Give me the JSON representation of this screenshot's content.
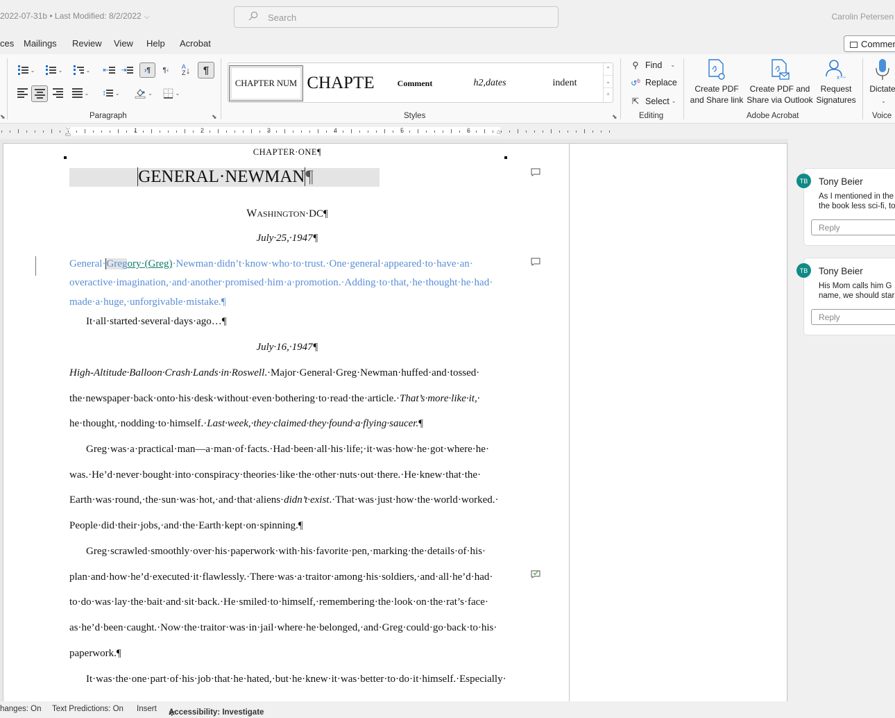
{
  "titlebar": {
    "doc_meta": "2022-07-31b  •  Last Modified: 8/2/2022",
    "search_placeholder": "Search",
    "user_name": "Carolin Petersen"
  },
  "tabs": [
    "ces",
    "Mailings",
    "Review",
    "View",
    "Help",
    "Acrobat"
  ],
  "comments_button": "Comments",
  "ribbon": {
    "groups": {
      "paragraph": "Paragraph",
      "styles": "Styles",
      "editing": "Editing",
      "adobe": "Adobe Acrobat",
      "voice": "Voice"
    },
    "paragraph_tools": {
      "bullets": "bullets-icon",
      "numbering": "numbering-icon",
      "multilevel": "multilevel-list-icon",
      "decrease_indent": "decrease-indent-icon",
      "increase_indent": "increase-indent-icon",
      "ltr": "left-to-right-icon",
      "rtl": "right-to-left-icon",
      "sort": "sort-icon",
      "show_marks": "pilcrow-icon",
      "align_left": "align-left-icon",
      "align_center": "align-center-icon",
      "align_right": "align-right-icon",
      "justify": "justify-icon",
      "line_spacing": "line-spacing-icon",
      "shading": "shading-icon",
      "borders": "borders-icon"
    },
    "styles": [
      "CHAPTER NUM",
      "CHAPTE",
      "Comment",
      "h2,dates",
      "indent"
    ],
    "editing": {
      "find": "Find",
      "replace": "Replace",
      "select": "Select"
    },
    "adobe": {
      "create_share_link": [
        "Create PDF",
        "and Share link"
      ],
      "create_share_outlook": [
        "Create PDF and",
        "Share via Outlook"
      ],
      "request_signatures": [
        "Request",
        "Signatures"
      ]
    },
    "voice": {
      "dictate": "Dictate"
    }
  },
  "ruler": {
    "labels": [
      "1",
      "2",
      "3",
      "4",
      "5",
      "6"
    ]
  },
  "document": {
    "chapter_label": "CHAPTER·ONE¶",
    "title": "GENERAL·NEWMAN",
    "title_mark": "¶",
    "location_first": "W",
    "location_rest": "ASHINGTON",
    "location_tail": "·DC¶",
    "date1": "July·25,·1947¶",
    "para_blue": {
      "line1_a": "General·",
      "line1_hl": "Greg",
      "line1_teal": "ory·(Greg)",
      "line1_b": "·Newman·didn’t·know·who·to·trust.·One·general·appeared·to·have·an·",
      "line2": "overactive·imagination,·and·another·promised·him·a·promotion.·Adding·to·that,·he·thought·he·had·",
      "line3": "made·a·huge,·unforgivable·mistake.¶"
    },
    "intro": "It·all·started·several·days·ago…¶",
    "date2": "July·16,·1947¶",
    "para1": {
      "l1_italic": "High-Altitude·Balloon·Crash·Lands·in·Roswell",
      "l1_rest": ".·Major·General·Greg·Newman·huffed·and·tossed·",
      "l2_a": "the·newspaper·back·onto·his·desk·without·even·bothering·to·read·the·article.·",
      "l2_italic": "That’s·more·like·it,·",
      "l3_a": "he·thought,·nodding·to·himself.·",
      "l3_italic": "Last·week,·they·claimed·they·found·a·flying·saucer.",
      "l3_mark": "¶"
    },
    "para2": {
      "l1": "Greg·was·a·practical·man—a·man·of·facts.·Had·been·all·his·life;·it·was·how·he·got·where·he·",
      "l2": "was.·He’d·never·bought·into·conspiracy·theories·like·the·other·nuts·out·there.·He·knew·that·the·",
      "l3_a": "Earth·was·round,·the·sun·was·hot,·and·that·aliens·",
      "l3_italic": "didn’t·exist",
      "l3_b": ".·That·was·just·how·the·world·worked.·",
      "l4": "People·did·their·jobs,·and·the·Earth·kept·on·spinning.¶"
    },
    "para3": {
      "l1": "Greg·scrawled·smoothly·over·his·paperwork·with·his·favorite·pen,·marking·the·details·of·his·",
      "l2": "plan·and·how·he’d·executed·it·flawlessly.·There·was·a·traitor·among·his·soldiers,·and·all·he’d·had·",
      "l3": "to·do·was·lay·the·bait·and·sit·back.·He·smiled·to·himself,·remembering·the·look·on·the·rat’s·face·",
      "l4": "as·he’d·been·caught.·Now·the·traitor·was·in·jail·where·he·belonged,·and·Greg·could·go·back·to·his·",
      "l5": "paperwork.¶"
    },
    "para4": {
      "l1": "It·was·the·one·part·of·his·job·that·he·hated,·but·he·knew·it·was·better·to·do·it·himself.·Especially·"
    }
  },
  "comments": [
    {
      "initials": "TB",
      "author": "Tony Beier",
      "text_line1": "As I mentioned in the",
      "text_line2": "the book less sci-fi, to",
      "reply_placeholder": "Reply"
    },
    {
      "initials": "TB",
      "author": "Tony Beier",
      "text_line1": "His Mom calls him G",
      "text_line2": "name, we should star",
      "reply_placeholder": "Reply"
    }
  ],
  "colors": {
    "avatar": "#108a86",
    "revision_blue": "#5a8ed6",
    "revision_teal": "#0e7a6a"
  },
  "statusbar": {
    "track_changes": "hanges: On",
    "text_predictions": "Text Predictions: On",
    "mode": "Insert",
    "accessibility": "Accessibility: Investigate"
  }
}
